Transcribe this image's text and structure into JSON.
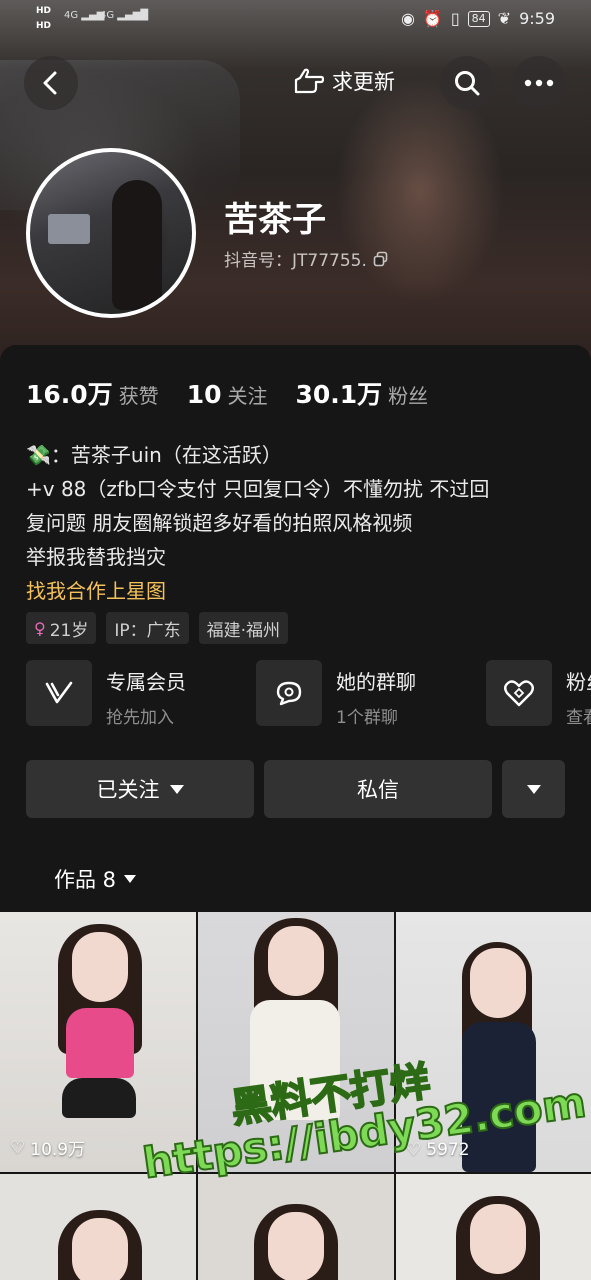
{
  "status_bar": {
    "left_top": "HD",
    "left_bottom": "HD",
    "signal1": "4G",
    "signal2": "4G",
    "battery": "84",
    "time": "9:59"
  },
  "nav": {
    "refresh_label": "求更新"
  },
  "profile": {
    "name": "苦茶子",
    "douyin_id": "抖音号：JT77755."
  },
  "stats": [
    {
      "num": "16.0万",
      "label": "获赞"
    },
    {
      "num": "10",
      "label": "关注"
    },
    {
      "num": "30.1万",
      "label": "粉丝"
    }
  ],
  "bio": {
    "line1": "：苦茶子uin（在这活跃）",
    "line2": "+v 88（zfb口令支付 只回复口令）不懂勿扰 不过回",
    "line3": "复问题 朋友圈解锁超多好看的拍照风格视频",
    "line4": "举报我替我挡灾",
    "link": "找我合作上星图"
  },
  "tags": {
    "age": "21岁",
    "ip": "IP：广东",
    "location": "福建·福州"
  },
  "features": [
    {
      "title": "专属会员",
      "subtitle": "抢先加入"
    },
    {
      "title": "她的群聊",
      "subtitle": "1个群聊"
    },
    {
      "title": "粉丝",
      "subtitle": "查看"
    }
  ],
  "actions": {
    "follow_label": "已关注",
    "message_label": "私信"
  },
  "works": {
    "tab_label": "作品 8"
  },
  "videos": [
    {
      "likes": "10.9万"
    },
    {
      "likes": ""
    },
    {
      "likes": "5972"
    }
  ],
  "watermark": {
    "line1": "黑料不打烊",
    "line2": "https://ibdy32.com"
  },
  "colors": {
    "link_gold": "#f4c15a",
    "panel_bg": "#161616",
    "button_bg": "#333232"
  }
}
